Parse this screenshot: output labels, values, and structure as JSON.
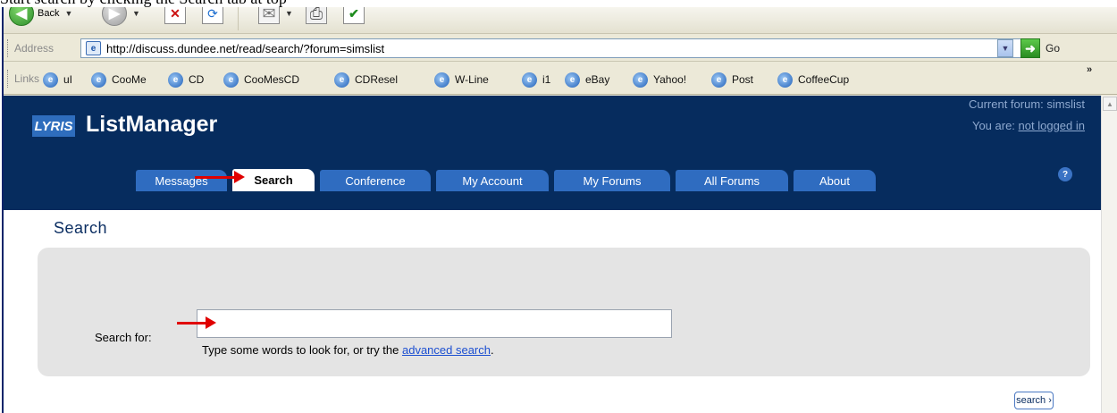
{
  "caption": {
    "text": "Start search by clicking the Search tab at top"
  },
  "toolbar": {
    "back_label": "Back",
    "icons": [
      "back-icon",
      "forward-icon",
      "stop-icon",
      "refresh-icon",
      "mail-icon",
      "print-icon",
      "edit-icon"
    ]
  },
  "address_bar": {
    "label": "Address",
    "url": "http://discuss.dundee.net/read/search/?forum=simslist",
    "go_label": "Go"
  },
  "links_bar": {
    "label": "Links",
    "items": [
      "uI",
      "CooMe",
      "CD",
      "CooMesCD",
      "CDResel",
      "W-Line",
      "i1",
      "eBay",
      "Yahoo!",
      "Post",
      "CoffeeCup"
    ]
  },
  "lyris": {
    "logo": "LYRIS",
    "product": "ListManager",
    "current_forum_label": "Current forum: simslist",
    "login_prefix": "You are:",
    "login_link": "not logged in"
  },
  "tabs": [
    {
      "label": "Messages",
      "active": false
    },
    {
      "label": "Search",
      "active": true
    },
    {
      "label": "Conference",
      "active": false
    },
    {
      "label": "My Account",
      "active": false
    },
    {
      "label": "My Forums",
      "active": false
    },
    {
      "label": "All Forums",
      "active": false
    },
    {
      "label": "About",
      "active": false
    }
  ],
  "search": {
    "title": "Search",
    "label": "Search for:",
    "input_value": "",
    "help_prefix": "Type some words to look for, or try the ",
    "help_link": "advanced search",
    "help_suffix": ".",
    "button_label": "search ›"
  },
  "colors": {
    "header_bg": "#062c5e",
    "tab_bg": "#2f6cc0",
    "arrow": "#e00000",
    "panel_bg": "#e4e4e4",
    "link": "#1c4fd1"
  }
}
